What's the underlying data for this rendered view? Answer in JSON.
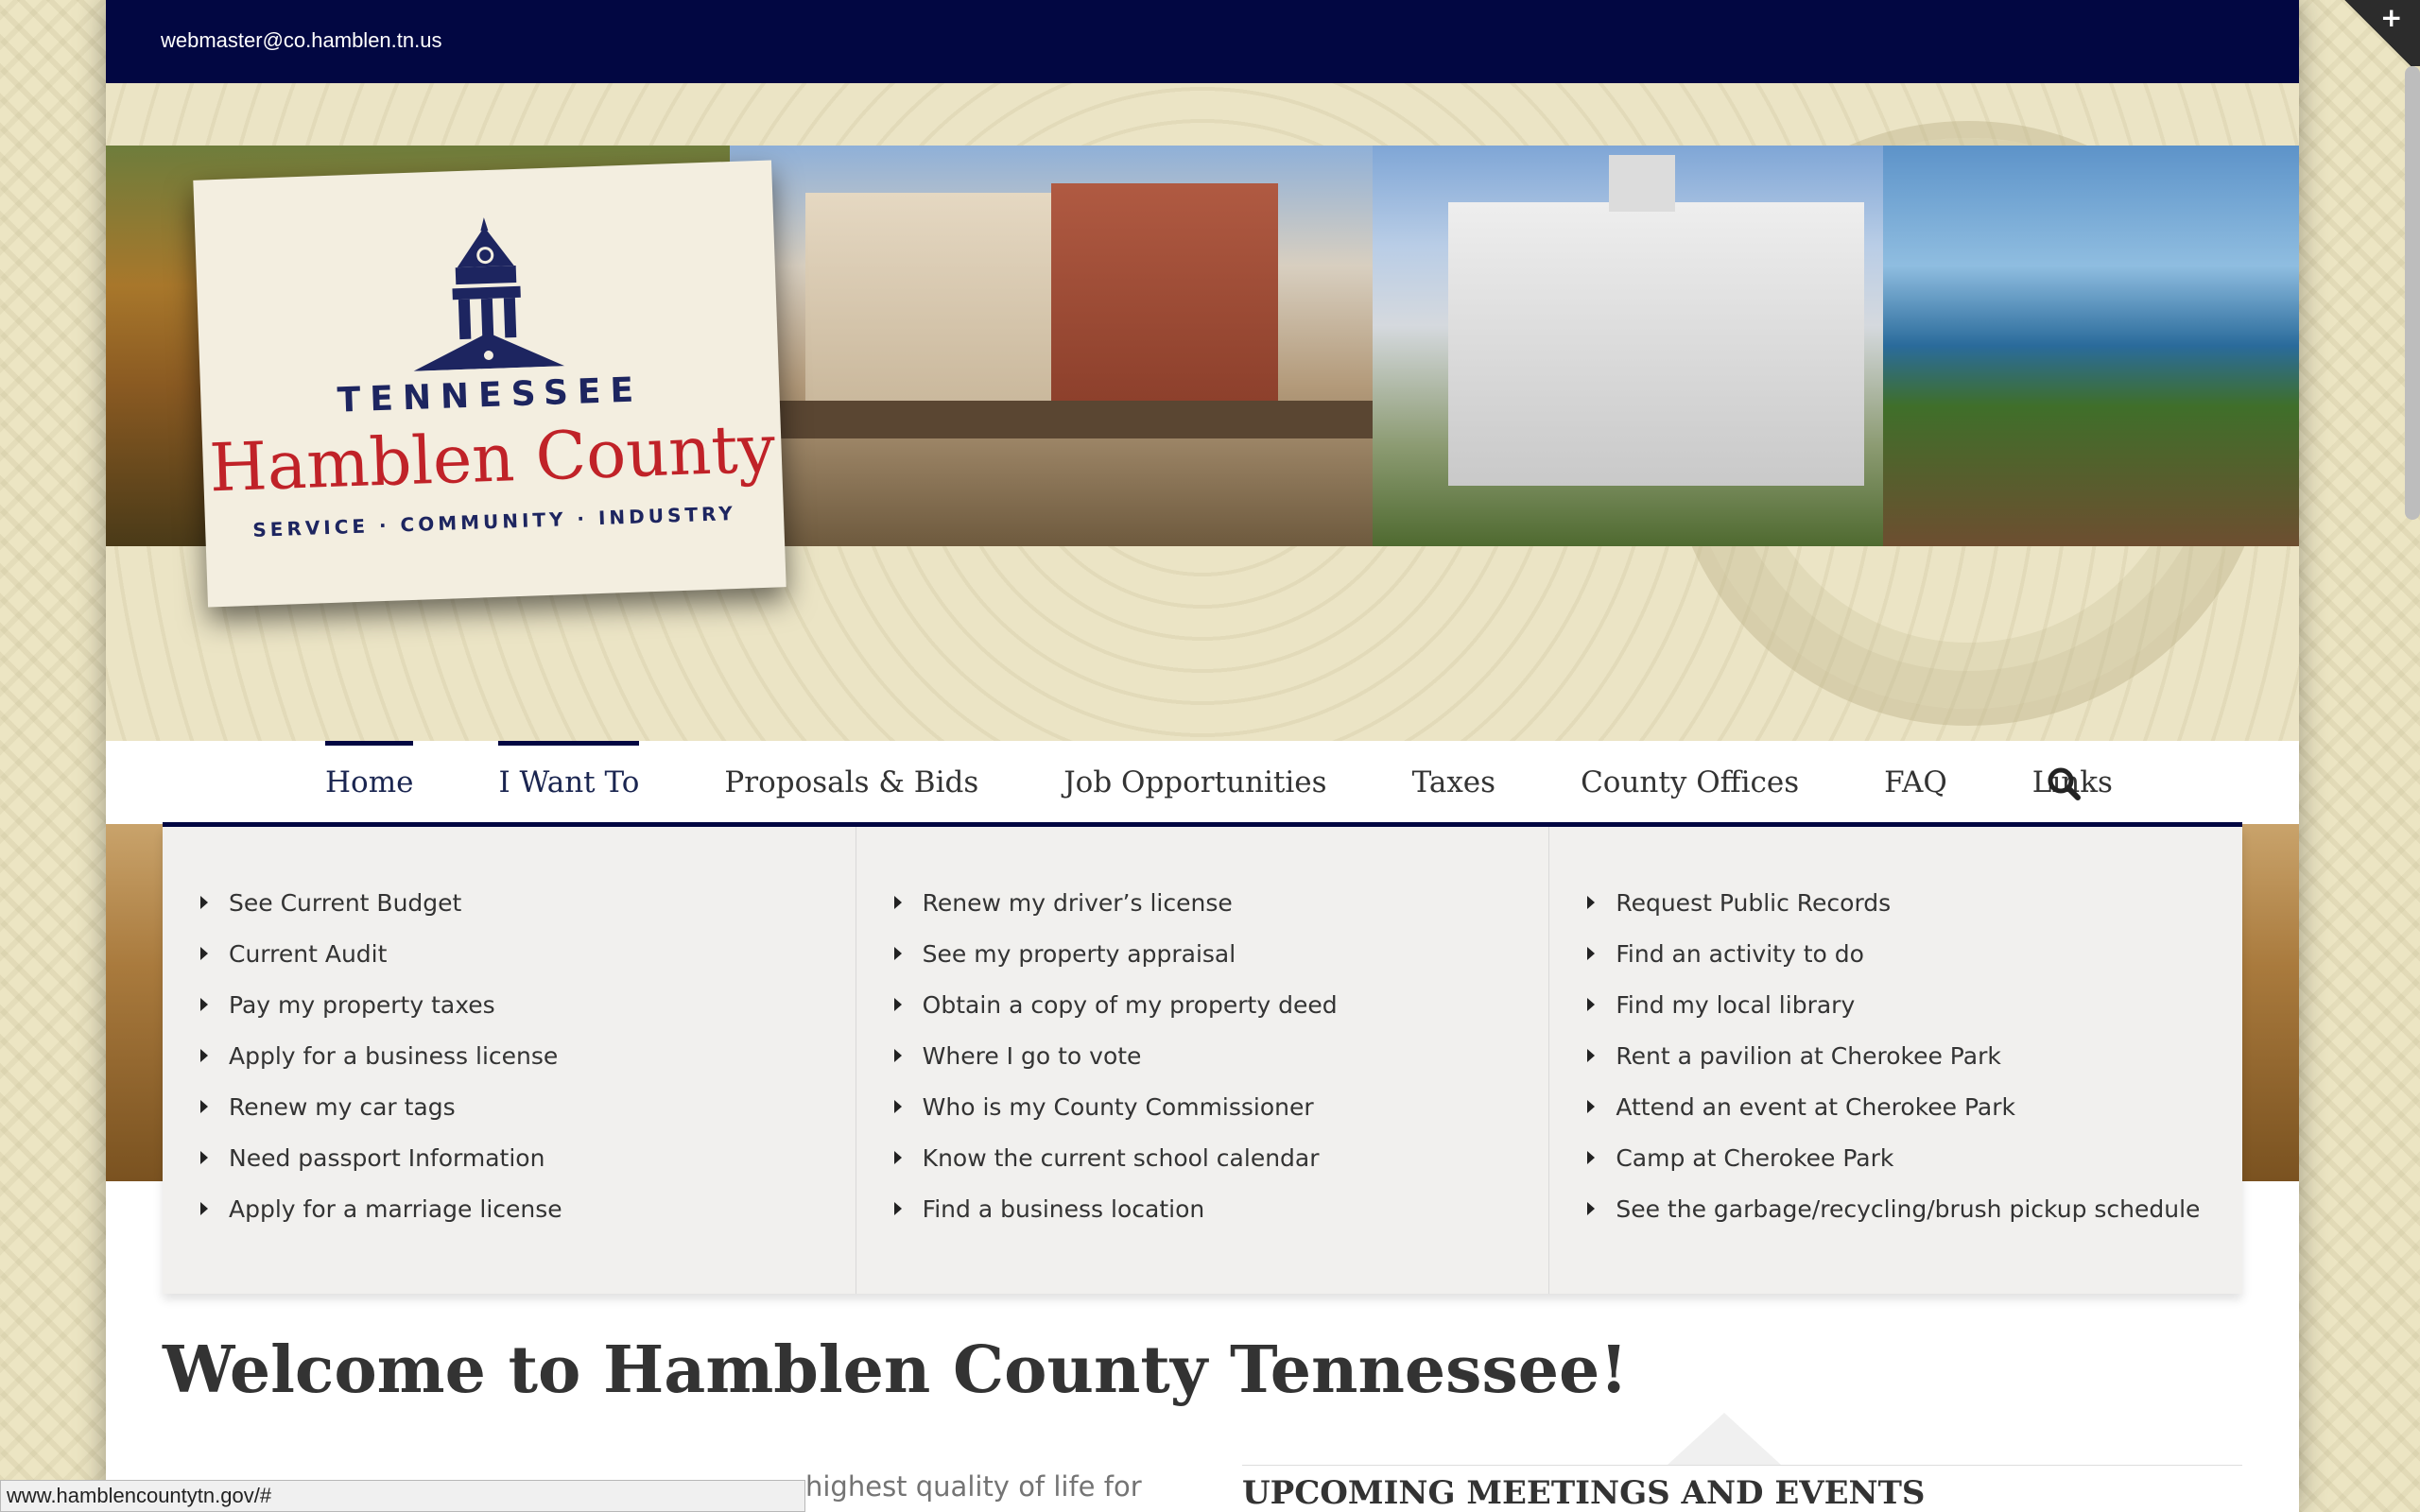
{
  "topbar": {
    "email": "webmaster@co.hamblen.tn.us"
  },
  "logo": {
    "state": "TENNESSEE",
    "name": "Hamblen County",
    "tagline": "SERVICE · COMMUNITY · INDUSTRY"
  },
  "nav": {
    "items": [
      {
        "label": "Home",
        "active": true
      },
      {
        "label": "I Want To",
        "active": true
      },
      {
        "label": "Proposals & Bids",
        "active": false
      },
      {
        "label": "Job Opportunities",
        "active": false
      },
      {
        "label": "Taxes",
        "active": false
      },
      {
        "label": "County Offices",
        "active": false
      },
      {
        "label": "FAQ",
        "active": false
      },
      {
        "label": "Links",
        "active": false
      }
    ],
    "search_icon": "search-icon"
  },
  "mega_menu": {
    "columns": [
      [
        "See Current Budget",
        "Current Audit",
        "Pay my property taxes",
        "Apply for a business license",
        "Renew my car tags",
        "Need passport Information",
        "Apply for a marriage license"
      ],
      [
        "Renew my driver’s license",
        "See my property appraisal",
        "Obtain a copy of my property deed",
        "Where I go to vote",
        "Who is my County Commissioner",
        "Know the current school calendar",
        "Find a business location"
      ],
      [
        "Request Public Records",
        "Find an activity to do",
        "Find my local library",
        "Rent a pavilion at Cherokee Park",
        "Attend an event at Cherokee Park",
        "Camp at Cherokee Park",
        "See the garbage/recycling/brush pickup schedule"
      ]
    ]
  },
  "main": {
    "welcome_title": "Welcome to Hamblen County Tennessee!",
    "intro_visible": "highest quality of life for",
    "events_heading": "UPCOMING MEETINGS AND EVENTS"
  },
  "status_bar": {
    "url": "www.hamblencountytn.gov/#"
  },
  "colors": {
    "navy": "#020742",
    "logo_red": "#c02228",
    "logo_blue": "#1d2560",
    "menu_bg": "#f1f0ee"
  }
}
